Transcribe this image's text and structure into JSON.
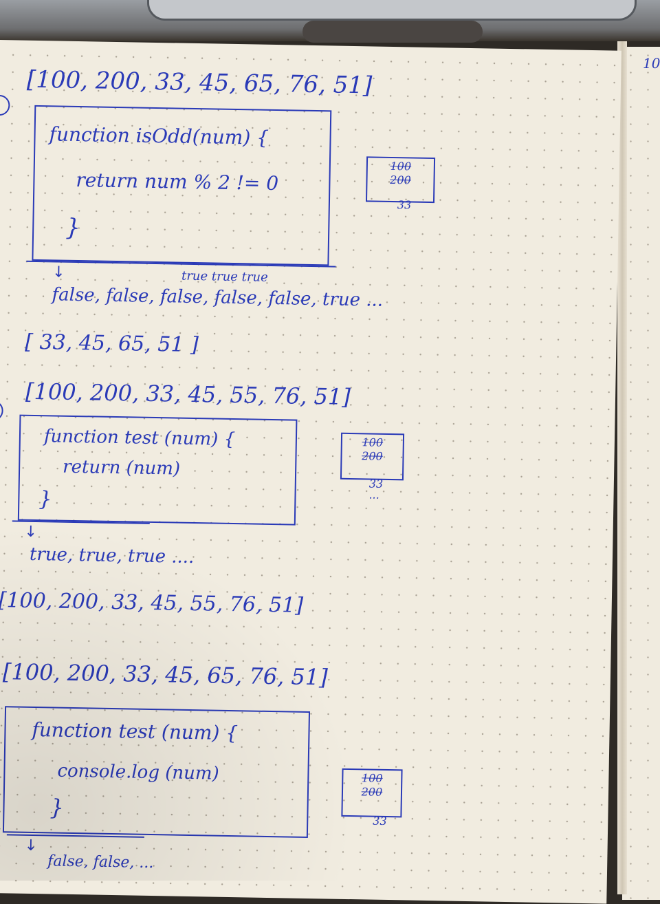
{
  "page_number": "10",
  "section1": {
    "input_array": "[100, 200, 33, 45, 65, 76, 51]",
    "code_line1": "function isOdd(num) {",
    "code_line2": "return num % 2 != 0",
    "code_line3": "}",
    "results_top": "true  true  true",
    "results": "false, false, false, false, false, true ...",
    "output_array": "[ 33, 45, 65, 51 ]",
    "stack": [
      "100",
      "200",
      "33"
    ]
  },
  "section2": {
    "input_array": "[100, 200, 33, 45, 55, 76, 51]",
    "code_line1": "function test (num) {",
    "code_line2": "return (num)",
    "code_line3": "}",
    "results": "true, true, true ....",
    "output_array": "[100, 200, 33, 45, 55, 76, 51]",
    "stack": [
      "100",
      "200",
      "33"
    ],
    "stack_more": "..."
  },
  "section3": {
    "input_array": "[100, 200, 33, 45, 65, 76, 51]",
    "code_line1": "function test (num) {",
    "code_line2": "console.log (num)",
    "code_line3": "}",
    "results": "false, false, ...",
    "stack": [
      "100",
      "200",
      "33"
    ]
  }
}
